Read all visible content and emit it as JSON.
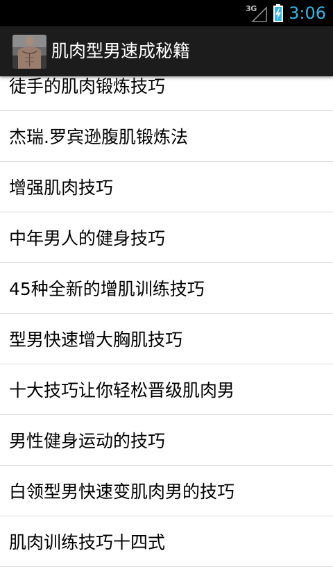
{
  "status_bar": {
    "network_type": "3G",
    "time": "3:06",
    "icons": [
      "signal-icon",
      "battery-charging-icon"
    ]
  },
  "action_bar": {
    "app_icon": "muscle-man-app-icon",
    "title": "肌肉型男速成秘籍"
  },
  "articles": [
    "徒手的肌肉锻炼技巧",
    "杰瑞.罗宾逊腹肌锻炼法",
    "增强肌肉技巧",
    "中年男人的健身技巧",
    "45种全新的增肌训练技巧",
    "型男快速增大胸肌技巧",
    "十大技巧让你轻松晋级肌肉男",
    "男性健身运动的技巧",
    "白领型男快速变肌肉男的技巧",
    "肌肉训练技巧十四式"
  ],
  "colors": {
    "clock": "#33b5e5",
    "action_bar": "#1c1c1c",
    "divider": "#d9d9d9"
  }
}
